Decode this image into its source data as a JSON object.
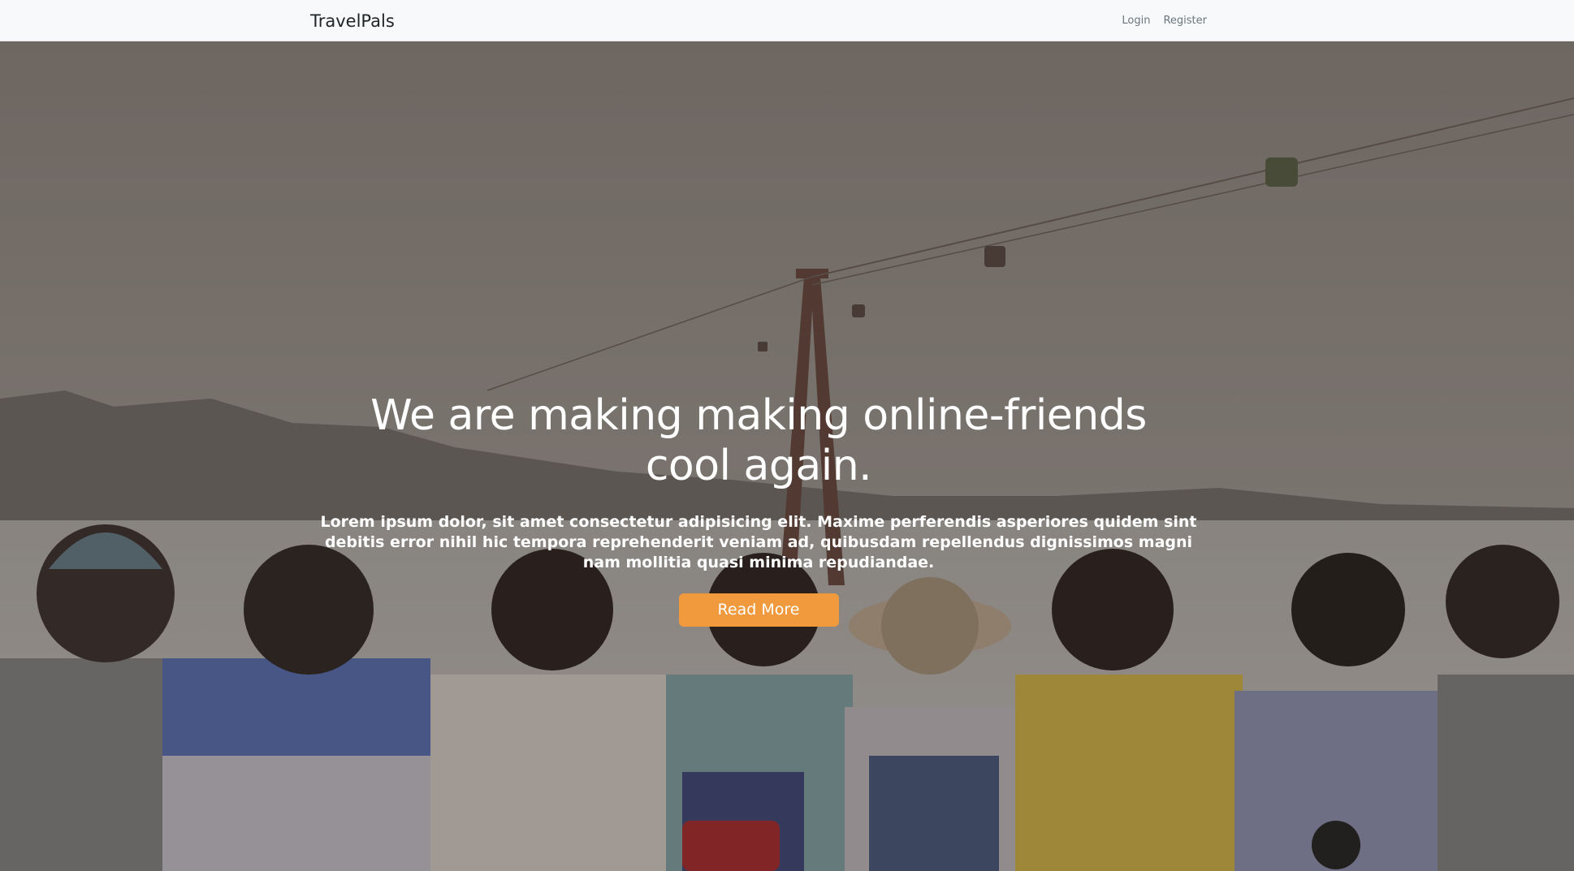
{
  "navbar": {
    "brand": "TravelPals",
    "links": [
      {
        "label": "Login"
      },
      {
        "label": "Register"
      }
    ]
  },
  "hero": {
    "title": "We are making making online-friends cool again.",
    "text": "Lorem ipsum dolor, sit amet consectetur adipisicing elit. Maxime perferendis asperiores quidem sint debitis error nihil hic tempora reprehenderit veniam ad, quibusdam repellendus dignissimos magni nam mollitia quasi minima repudiandae.",
    "button_label": "Read More",
    "button_color": "#f0993d",
    "background_description_icon": "group-of-friends-photo"
  },
  "colors": {
    "navbar_bg": "#f8f9fa",
    "brand_text": "#212529",
    "nav_link": "#6c757d",
    "hero_text": "#ffffff",
    "accent": "#f0993d"
  }
}
